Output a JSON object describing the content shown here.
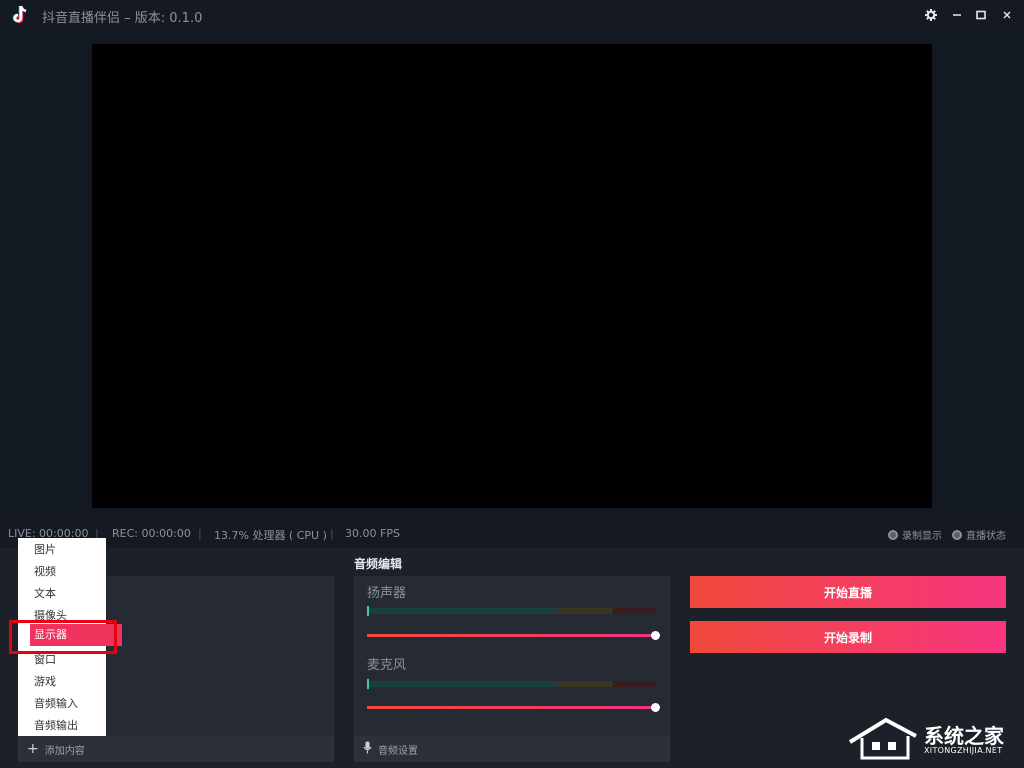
{
  "window": {
    "title": "抖音直播伴侣 – 版本: 0.1.0",
    "controls": {
      "settings_icon": "gear-icon",
      "minimize_icon": "minimize-icon",
      "maximize_icon": "maximize-icon",
      "close_icon": "close-icon"
    }
  },
  "status": {
    "live": "LIVE: 00:00:00",
    "rec": "REC: 00:00:00",
    "cpu": "13.7% 处理器 ( CPU )",
    "fps": "30.00 FPS",
    "options": [
      "录制显示",
      "直播状态"
    ]
  },
  "sources": {
    "menu": [
      "图片",
      "视频",
      "文本",
      "摄像头",
      "显示器",
      "窗口",
      "游戏",
      "音频输入",
      "音频输出"
    ],
    "selected": "显示器",
    "add_label": "添加内容"
  },
  "audio": {
    "header": "音频编辑",
    "channels": [
      {
        "label": "扬声器",
        "level": 0.0,
        "volume": 1.0
      },
      {
        "label": "麦克风",
        "level": 0.0,
        "volume": 1.0
      }
    ],
    "settings_label": "音频设置"
  },
  "actions": {
    "start_live": "开始直播",
    "start_record": "开始录制"
  },
  "watermark": {
    "text": "系统之家",
    "sub": "XITONGZHIJIA.NET"
  },
  "colors": {
    "accent": "#f0337f",
    "accent_start": "#f04a3c",
    "highlight": "#e60012"
  }
}
